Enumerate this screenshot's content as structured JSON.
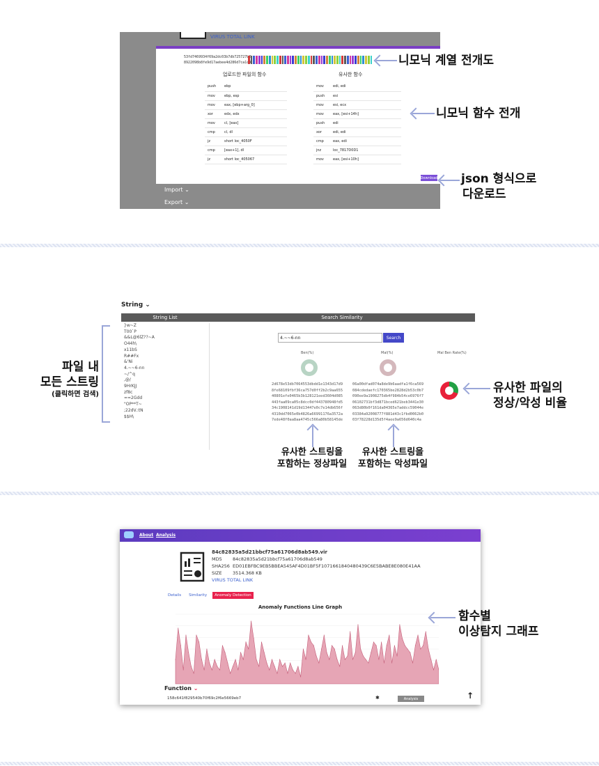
{
  "panel1": {
    "vt_link": "VIRUS TOTAL LINK",
    "hash_lines": [
      "53fd7469934f69a2dc03b7db725727b2",
      "8922098b8fe9d17aebee4d286d7ca1c9"
    ],
    "col_uploaded": "업로드한 파일의 함수",
    "col_similar": "유사한 함수",
    "uploaded_rows": [
      [
        "push",
        "ebp"
      ],
      [
        "mov",
        "ebp, esp"
      ],
      [
        "mov",
        "eax, [ebp+arg_0]"
      ],
      [
        "xor",
        "edx, edx"
      ],
      [
        "mov",
        "cl, [eax]"
      ],
      [
        "cmp",
        "cl, dl"
      ],
      [
        "jz",
        "short loc_4050F"
      ],
      [
        "cmp",
        "[eax+1], dl"
      ],
      [
        "jz",
        "short loc_405067"
      ]
    ],
    "similar_rows": [
      [
        "mov",
        "edi, edi"
      ],
      [
        "push",
        "esi"
      ],
      [
        "mov",
        "esi, ecx"
      ],
      [
        "mov",
        "eax, [esi+14h]"
      ],
      [
        "push",
        "edi"
      ],
      [
        "xor",
        "edi, edi"
      ],
      [
        "cmp",
        "eax, edi"
      ],
      [
        "jnz",
        "loc_7817D0D1"
      ],
      [
        "mov",
        "eax, [esi+10h]"
      ]
    ],
    "download_label": "Download",
    "menu_import": "Import ⌄",
    "menu_export": "Export ⌄",
    "bar_colors": [
      "#d23b3b",
      "#3bd264",
      "#3b5fd2",
      "#d2c43b",
      "#9b3bd2",
      "#3bd2c9",
      "#d2823b",
      "#5a5a5a",
      "#2f8fd2",
      "#d23b9b",
      "#8cd23b",
      "#3b3bd2"
    ]
  },
  "annotations": {
    "mnemonic_seq": "니모닉 계열 전개도",
    "mnemonic_func": "니모닉 함수 전개",
    "json_download_l1": "json 형식으로",
    "json_download_l2": "다운로드",
    "file_strings_l1": "파일 내",
    "file_strings_l2": "모든 스트링",
    "file_strings_l3": "(클릭하면 검색)",
    "ratio_l1": "유사한 파일의",
    "ratio_l2": "정상/악성 비율",
    "benign_l1": "유사한 스트링을",
    "benign_l2": "포함하는 정상파일",
    "mal_l1": "유사한 스트링을",
    "mal_l2": "포함하는 악성파일",
    "graph_l1": "함수별",
    "graph_l2": "이상탐지 그래프"
  },
  "panel2": {
    "section_title": "String ⌄",
    "col_string_list": "String List",
    "col_search": "Search Similarity",
    "strings": [
      "}w~Z",
      "T00`P",
      "&&L@6lZ??~A",
      "O44h\\",
      "x11bS",
      "R##Fx",
      "&'Ni",
      "4.~~6-nn",
      "~/^q",
      ",@/",
      "9HrKJJ",
      "zf8c",
      "==2Gdd",
      "\"OP**T~",
      ";22dV.:tN",
      "$$H\\"
    ],
    "search_value": "4.~~6-nn",
    "search_button": "Search",
    "benign_header": "Ben(%)",
    "mal_header": "Mal(%)",
    "ratio_header": "Mal Ben Rate(%)",
    "benign_hashes": [
      "2d678e53db7064553dbdd1e1343d17d9",
      "8fe68109fbf36ca757d0ff2b2c9aa655",
      "40801efe0465b3b128121eed3604d085",
      "443faa09ca05c8dcc0df443780948fd5",
      "34c1908141d19d13447e0c7e14db656f",
      "4310dd7065e0b4826a66991176a3572a",
      "7ede48f0aa8aa4745c566a80b58145de"
    ],
    "mal_hashes": [
      "06a00dfad074a8de9b6aadfa1f6ca569",
      "084cdedaefc170365be2828d2b53c0b7",
      "090ee9a1908275db4f984b54ce6976f7",
      "06102731bf3d871bced621beb3441e30",
      "063d80b0f161da04365e7addcc59044e",
      "03384a92008777f881d43c1fbd0062b0",
      "03f78228d135d5f4aee9a656d640c4a"
    ],
    "mal_ratio_pct": 70
  },
  "panel3": {
    "nav_about": "About",
    "nav_analysis": "Analysis",
    "file_name": "84c82835a5d21bbcf75a61706d8ab549.vir",
    "md5_label": "MD5",
    "md5_value": "84c82835a5d21bbcf75a61706d8ab549",
    "sha_label": "SHA256",
    "sha_value": "ED01EBFBC9EB5BBEA545AF4D01BF5F1071661840480439C6E5BABE8E080E41AA",
    "size_label": "SIZE",
    "size_value": "3514.368 KB",
    "vt_link": "VIRUS TOTAL LINK",
    "tab_details": "Details",
    "tab_similarity": "Similarity",
    "tab_anomaly": "Anomaly Detection",
    "graph_title": "Anomaly Functions Line Graph",
    "function_label": "Function",
    "function_hash": "158c641f829540b70f69c2f6e5669eb7",
    "analysis_button": "Analysis",
    "accent": "#e8214c"
  },
  "chart_data": {
    "type": "area",
    "title": "Anomaly Functions Line Graph",
    "xlabel": "",
    "ylabel": "",
    "ylim": [
      0,
      1
    ],
    "values": [
      0.35,
      0.8,
      0.55,
      0.2,
      0.7,
      0.45,
      0.25,
      0.15,
      0.7,
      0.6,
      0.35,
      0.2,
      0.5,
      0.3,
      0.2,
      0.35,
      0.25,
      0.2,
      0.55,
      0.45,
      0.3,
      0.15,
      0.25,
      0.35,
      0.2,
      0.45,
      0.35,
      0.6,
      0.5,
      0.9,
      0.65,
      0.35,
      0.25,
      0.6,
      0.45,
      0.3,
      0.2,
      0.35,
      0.25,
      0.15,
      0.35,
      0.25,
      0.3,
      0.15,
      0.3,
      0.2,
      0.15,
      0.25,
      0.1,
      0.5,
      0.35,
      0.7,
      0.6,
      0.55,
      0.4,
      0.3,
      0.5,
      0.7,
      0.45,
      0.35,
      0.55,
      0.5,
      0.35,
      0.25,
      0.55,
      0.35,
      0.4,
      0.75,
      0.35,
      0.45,
      0.85,
      0.5,
      0.4,
      0.35,
      0.3,
      0.45,
      0.6,
      0.55,
      0.35,
      0.6,
      0.3,
      0.55,
      0.7,
      0.3,
      0.55,
      0.4,
      0.85,
      0.65,
      0.55,
      0.5,
      0.45,
      0.3,
      0.55,
      0.7,
      0.5,
      0.55,
      0.75,
      0.5,
      0.35,
      0.2,
      0.35,
      0.2
    ]
  }
}
